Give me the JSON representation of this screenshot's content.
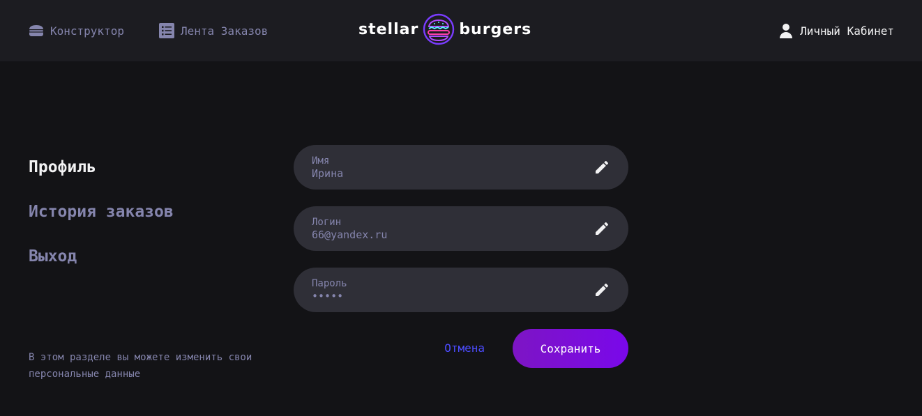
{
  "header": {
    "nav_constructor": "Конструктор",
    "nav_feed": "Лента Заказов",
    "logo_left": "stellar",
    "logo_right": "burgers",
    "nav_account": "Личный Кабинет"
  },
  "sidebar": {
    "items": [
      {
        "label": "Профиль",
        "active": true
      },
      {
        "label": "История заказов",
        "active": false
      },
      {
        "label": "Выход",
        "active": false
      }
    ],
    "note": "В этом разделе вы можете изменить свои персональные данные"
  },
  "form": {
    "fields": [
      {
        "label": "Имя",
        "value": "Ирина"
      },
      {
        "label": "Логин",
        "value": "66@yandex.ru"
      },
      {
        "label": "Пароль",
        "value": "•••••"
      }
    ],
    "cancel_label": "Отмена",
    "save_label": "Сохранить"
  },
  "colors": {
    "background": "#131316",
    "header": "#1c1c21",
    "field": "#2f2f37",
    "inactive": "#8585ad",
    "accent": "#4c4cff",
    "button_from": "#7d15c4",
    "button_to": "#7a08ea"
  },
  "icons": {
    "constructor": "burger-icon",
    "feed": "list-icon",
    "account": "profile-icon",
    "edit": "pencil-icon"
  }
}
